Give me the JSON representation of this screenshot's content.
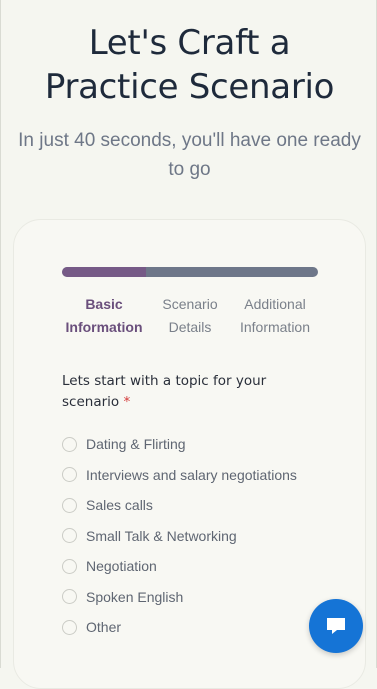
{
  "header": {
    "title_line1": "Let's Craft a",
    "title_line2": "Practice Scenario",
    "subtitle": "In just 40 seconds, you'll have one ready to go"
  },
  "progress": {
    "fraction_complete": 0.33
  },
  "steps": [
    {
      "line1": "Basic",
      "line2": "Information",
      "active": true
    },
    {
      "line1": "Scenario",
      "line2": "Details",
      "active": false
    },
    {
      "line1": "Additional",
      "line2": "Information",
      "active": false
    }
  ],
  "form": {
    "question": "Lets start with a topic for your scenario",
    "required_marker": "*",
    "options": [
      "Dating & Flirting",
      "Interviews and salary negotiations",
      "Sales calls",
      "Small Talk & Networking",
      "Negotiation",
      "Spoken English",
      "Other"
    ]
  },
  "chat": {
    "icon": "chat-bubble-icon",
    "color": "#1574d6"
  },
  "colors": {
    "accent": "#765a86",
    "progress_track": "#6e7789",
    "title": "#1e2a3b"
  }
}
